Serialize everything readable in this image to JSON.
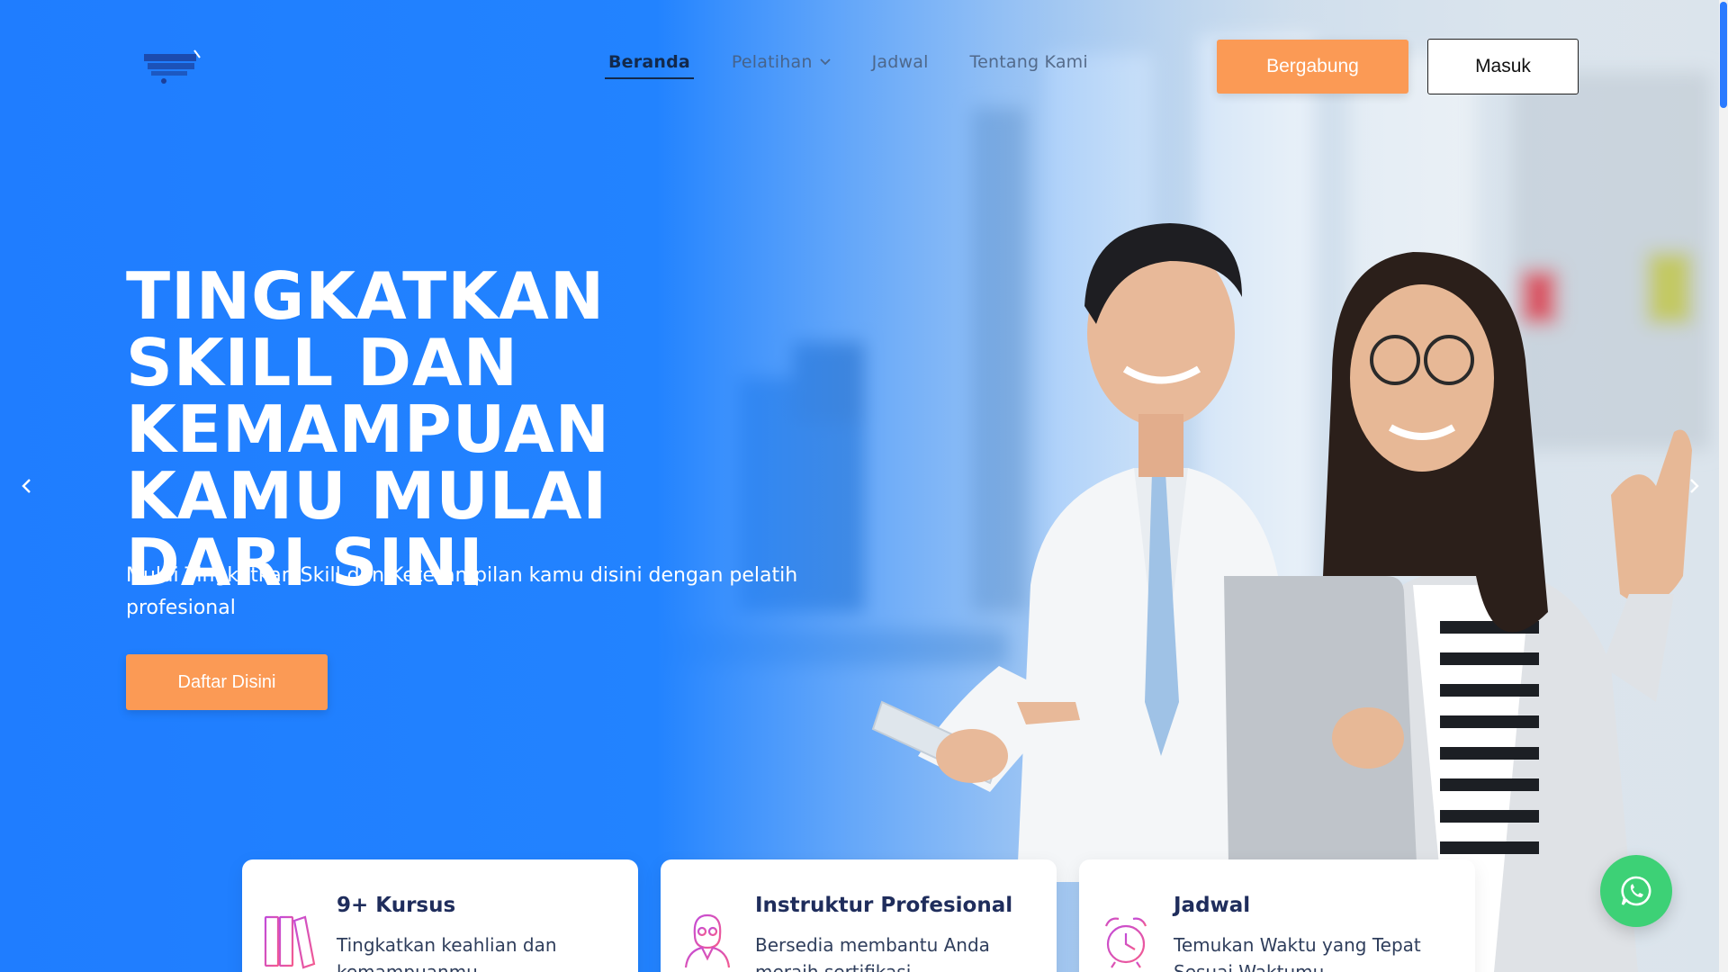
{
  "nav": {
    "items": [
      {
        "label": "Beranda",
        "active": true
      },
      {
        "label": "Pelatihan",
        "active": false,
        "has_dropdown": true
      },
      {
        "label": "Jadwal",
        "active": false
      },
      {
        "label": "Tentang Kami",
        "active": false
      }
    ],
    "join_label": "Bergabung",
    "login_label": "Masuk"
  },
  "hero": {
    "headline": "TINGKATKAN SKILL DAN KEMAMPUAN KAMU MULAI DARI SINI",
    "subtext": "Mulai Tingkatkan Skill dan Keterampilan kamu disini dengan pelatih profesional",
    "cta_label": "Daftar Disini"
  },
  "cards": [
    {
      "title": "9+ Kursus",
      "desc": "Tingkatkan keahlian dan kemampuanmu",
      "icon": "books-icon"
    },
    {
      "title": "Instruktur Profesional",
      "desc": "Bersedia membantu Anda meraih sertifikasi",
      "icon": "instructor-icon"
    },
    {
      "title": "Jadwal",
      "desc": "Temukan Waktu yang Tepat Sesuai Waktumu",
      "icon": "alarm-clock-icon"
    }
  ],
  "colors": {
    "primary_blue": "#1f7dff",
    "accent_orange": "#fb9a55",
    "nav_dark": "#13294b",
    "whatsapp_green": "#3dd176"
  }
}
